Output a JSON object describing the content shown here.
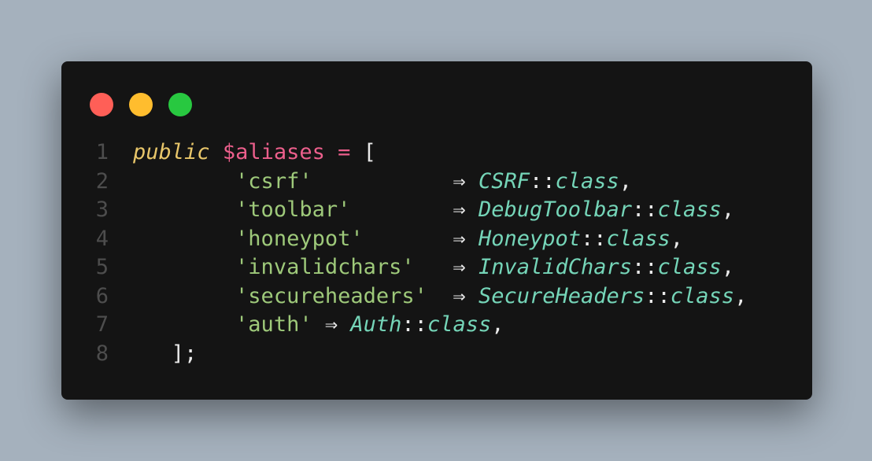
{
  "window": {
    "controls": [
      {
        "name": "close",
        "color": "#ff5f57"
      },
      {
        "name": "minimize",
        "color": "#ffbd2e"
      },
      {
        "name": "maximize",
        "color": "#28c840"
      }
    ]
  },
  "code": {
    "lines": [
      {
        "number": "1",
        "tokens": [
          {
            "t": "kw",
            "v": "public"
          },
          {
            "t": "pl",
            "v": " "
          },
          {
            "t": "var",
            "v": "$aliases"
          },
          {
            "t": "pl",
            "v": " "
          },
          {
            "t": "var",
            "v": "="
          },
          {
            "t": "pl",
            "v": " ["
          }
        ]
      },
      {
        "number": "2",
        "tokens": [
          {
            "t": "pl",
            "v": "        "
          },
          {
            "t": "str",
            "v": "'csrf'"
          },
          {
            "t": "pl",
            "v": "           "
          },
          {
            "t": "op",
            "v": "⇒"
          },
          {
            "t": "pl",
            "v": " "
          },
          {
            "t": "cls",
            "v": "CSRF"
          },
          {
            "t": "pl",
            "v": "::"
          },
          {
            "t": "cls",
            "v": "class"
          },
          {
            "t": "pl",
            "v": ","
          }
        ]
      },
      {
        "number": "3",
        "tokens": [
          {
            "t": "pl",
            "v": "        "
          },
          {
            "t": "str",
            "v": "'toolbar'"
          },
          {
            "t": "pl",
            "v": "        "
          },
          {
            "t": "op",
            "v": "⇒"
          },
          {
            "t": "pl",
            "v": " "
          },
          {
            "t": "cls",
            "v": "DebugToolbar"
          },
          {
            "t": "pl",
            "v": "::"
          },
          {
            "t": "cls",
            "v": "class"
          },
          {
            "t": "pl",
            "v": ","
          }
        ]
      },
      {
        "number": "4",
        "tokens": [
          {
            "t": "pl",
            "v": "        "
          },
          {
            "t": "str",
            "v": "'honeypot'"
          },
          {
            "t": "pl",
            "v": "       "
          },
          {
            "t": "op",
            "v": "⇒"
          },
          {
            "t": "pl",
            "v": " "
          },
          {
            "t": "cls",
            "v": "Honeypot"
          },
          {
            "t": "pl",
            "v": "::"
          },
          {
            "t": "cls",
            "v": "class"
          },
          {
            "t": "pl",
            "v": ","
          }
        ]
      },
      {
        "number": "5",
        "tokens": [
          {
            "t": "pl",
            "v": "        "
          },
          {
            "t": "str",
            "v": "'invalidchars'"
          },
          {
            "t": "pl",
            "v": "   "
          },
          {
            "t": "op",
            "v": "⇒"
          },
          {
            "t": "pl",
            "v": " "
          },
          {
            "t": "cls",
            "v": "InvalidChars"
          },
          {
            "t": "pl",
            "v": "::"
          },
          {
            "t": "cls",
            "v": "class"
          },
          {
            "t": "pl",
            "v": ","
          }
        ]
      },
      {
        "number": "6",
        "tokens": [
          {
            "t": "pl",
            "v": "        "
          },
          {
            "t": "str",
            "v": "'secureheaders'"
          },
          {
            "t": "pl",
            "v": "  "
          },
          {
            "t": "op",
            "v": "⇒"
          },
          {
            "t": "pl",
            "v": " "
          },
          {
            "t": "cls",
            "v": "SecureHeaders"
          },
          {
            "t": "pl",
            "v": "::"
          },
          {
            "t": "cls",
            "v": "class"
          },
          {
            "t": "pl",
            "v": ","
          }
        ]
      },
      {
        "number": "7",
        "tokens": [
          {
            "t": "pl",
            "v": "        "
          },
          {
            "t": "str",
            "v": "'auth'"
          },
          {
            "t": "pl",
            "v": " "
          },
          {
            "t": "op",
            "v": "⇒"
          },
          {
            "t": "pl",
            "v": " "
          },
          {
            "t": "cls",
            "v": "Auth"
          },
          {
            "t": "pl",
            "v": "::"
          },
          {
            "t": "cls",
            "v": "class"
          },
          {
            "t": "pl",
            "v": ","
          }
        ]
      },
      {
        "number": "8",
        "tokens": [
          {
            "t": "pl",
            "v": "   ];"
          }
        ]
      }
    ]
  }
}
